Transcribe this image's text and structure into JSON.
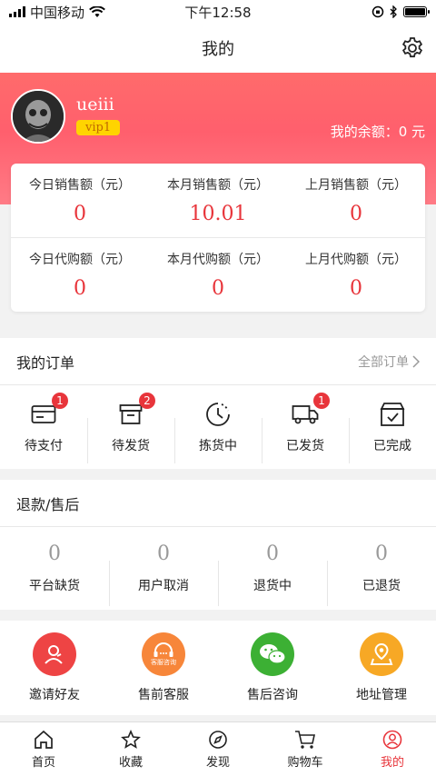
{
  "status_bar": {
    "carrier": "中国移动",
    "time": "下午12:58"
  },
  "nav": {
    "title": "我的"
  },
  "profile": {
    "username": "ueiii",
    "vip": "vip1",
    "balance": "我的余额：0 元"
  },
  "stats": [
    {
      "label": "今日销售额（元）",
      "value": "0"
    },
    {
      "label": "本月销售额（元）",
      "value": "10.01"
    },
    {
      "label": "上月销售额（元）",
      "value": "0"
    },
    {
      "label": "今日代购额（元）",
      "value": "0"
    },
    {
      "label": "本月代购额（元）",
      "value": "0"
    },
    {
      "label": "上月代购额（元）",
      "value": "0"
    }
  ],
  "orders": {
    "title": "我的订单",
    "all_label": "全部订单",
    "items": [
      {
        "label": "待支付",
        "badge": "1",
        "icon": "card-icon"
      },
      {
        "label": "待发货",
        "badge": "2",
        "icon": "box-icon"
      },
      {
        "label": "拣货中",
        "badge": "",
        "icon": "clock-icon"
      },
      {
        "label": "已发货",
        "badge": "1",
        "icon": "truck-icon"
      },
      {
        "label": "已完成",
        "badge": "",
        "icon": "done-box-icon"
      }
    ]
  },
  "refunds": {
    "title": "退款/售后",
    "items": [
      {
        "label": "平台缺货",
        "value": "0"
      },
      {
        "label": "用户取消",
        "value": "0"
      },
      {
        "label": "退货中",
        "value": "0"
      },
      {
        "label": "已退货",
        "value": "0"
      }
    ]
  },
  "services": [
    {
      "label": "邀请好友",
      "color": "#ee4444",
      "icon": "invite-icon"
    },
    {
      "label": "售前客服",
      "color": "#f7863a",
      "icon": "headset-icon",
      "icon_text": "客服咨询"
    },
    {
      "label": "售后咨询",
      "color": "#3cb034",
      "icon": "wechat-icon"
    },
    {
      "label": "地址管理",
      "color": "#f7a825",
      "icon": "location-icon"
    }
  ],
  "tabs": [
    {
      "label": "首页",
      "icon": "home-icon"
    },
    {
      "label": "收藏",
      "icon": "star-icon"
    },
    {
      "label": "发现",
      "icon": "compass-icon"
    },
    {
      "label": "购物车",
      "icon": "cart-icon"
    },
    {
      "label": "我的",
      "icon": "user-icon",
      "active": true
    }
  ],
  "colors": {
    "accent": "#e8353b",
    "header_gradient_top": "#ff6b6b",
    "vip_badge": "#ffd400"
  }
}
